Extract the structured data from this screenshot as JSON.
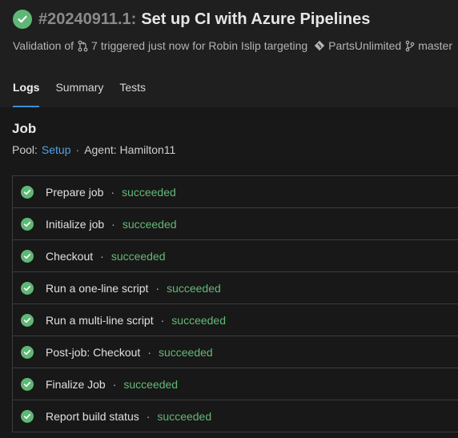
{
  "header": {
    "build_id": "#20240911.1:",
    "title": "Set up CI with Azure Pipelines",
    "subtitle": {
      "prefix": "Validation of",
      "pr_number": "7",
      "middle": "triggered just now for Robin Islip targeting",
      "repo": "PartsUnlimited",
      "branch": "master"
    }
  },
  "tabs": [
    {
      "label": "Logs",
      "active": true
    },
    {
      "label": "Summary",
      "active": false
    },
    {
      "label": "Tests",
      "active": false
    }
  ],
  "job": {
    "title": "Job",
    "pool_label": "Pool:",
    "pool_value": "Setup",
    "separator": "·",
    "agent_text": "Agent: Hamilton11"
  },
  "steps": [
    {
      "name": "Prepare job",
      "status": "succeeded"
    },
    {
      "name": "Initialize job",
      "status": "succeeded"
    },
    {
      "name": "Checkout",
      "status": "succeeded"
    },
    {
      "name": "Run a one-line script",
      "status": "succeeded"
    },
    {
      "name": "Run a multi-line script",
      "status": "succeeded"
    },
    {
      "name": "Post-job: Checkout",
      "status": "succeeded"
    },
    {
      "name": "Finalize Job",
      "status": "succeeded"
    },
    {
      "name": "Report build status",
      "status": "succeeded"
    }
  ],
  "colors": {
    "success": "#5fb776",
    "link": "#4ea1e8",
    "tab_underline": "#3a8fd6"
  }
}
